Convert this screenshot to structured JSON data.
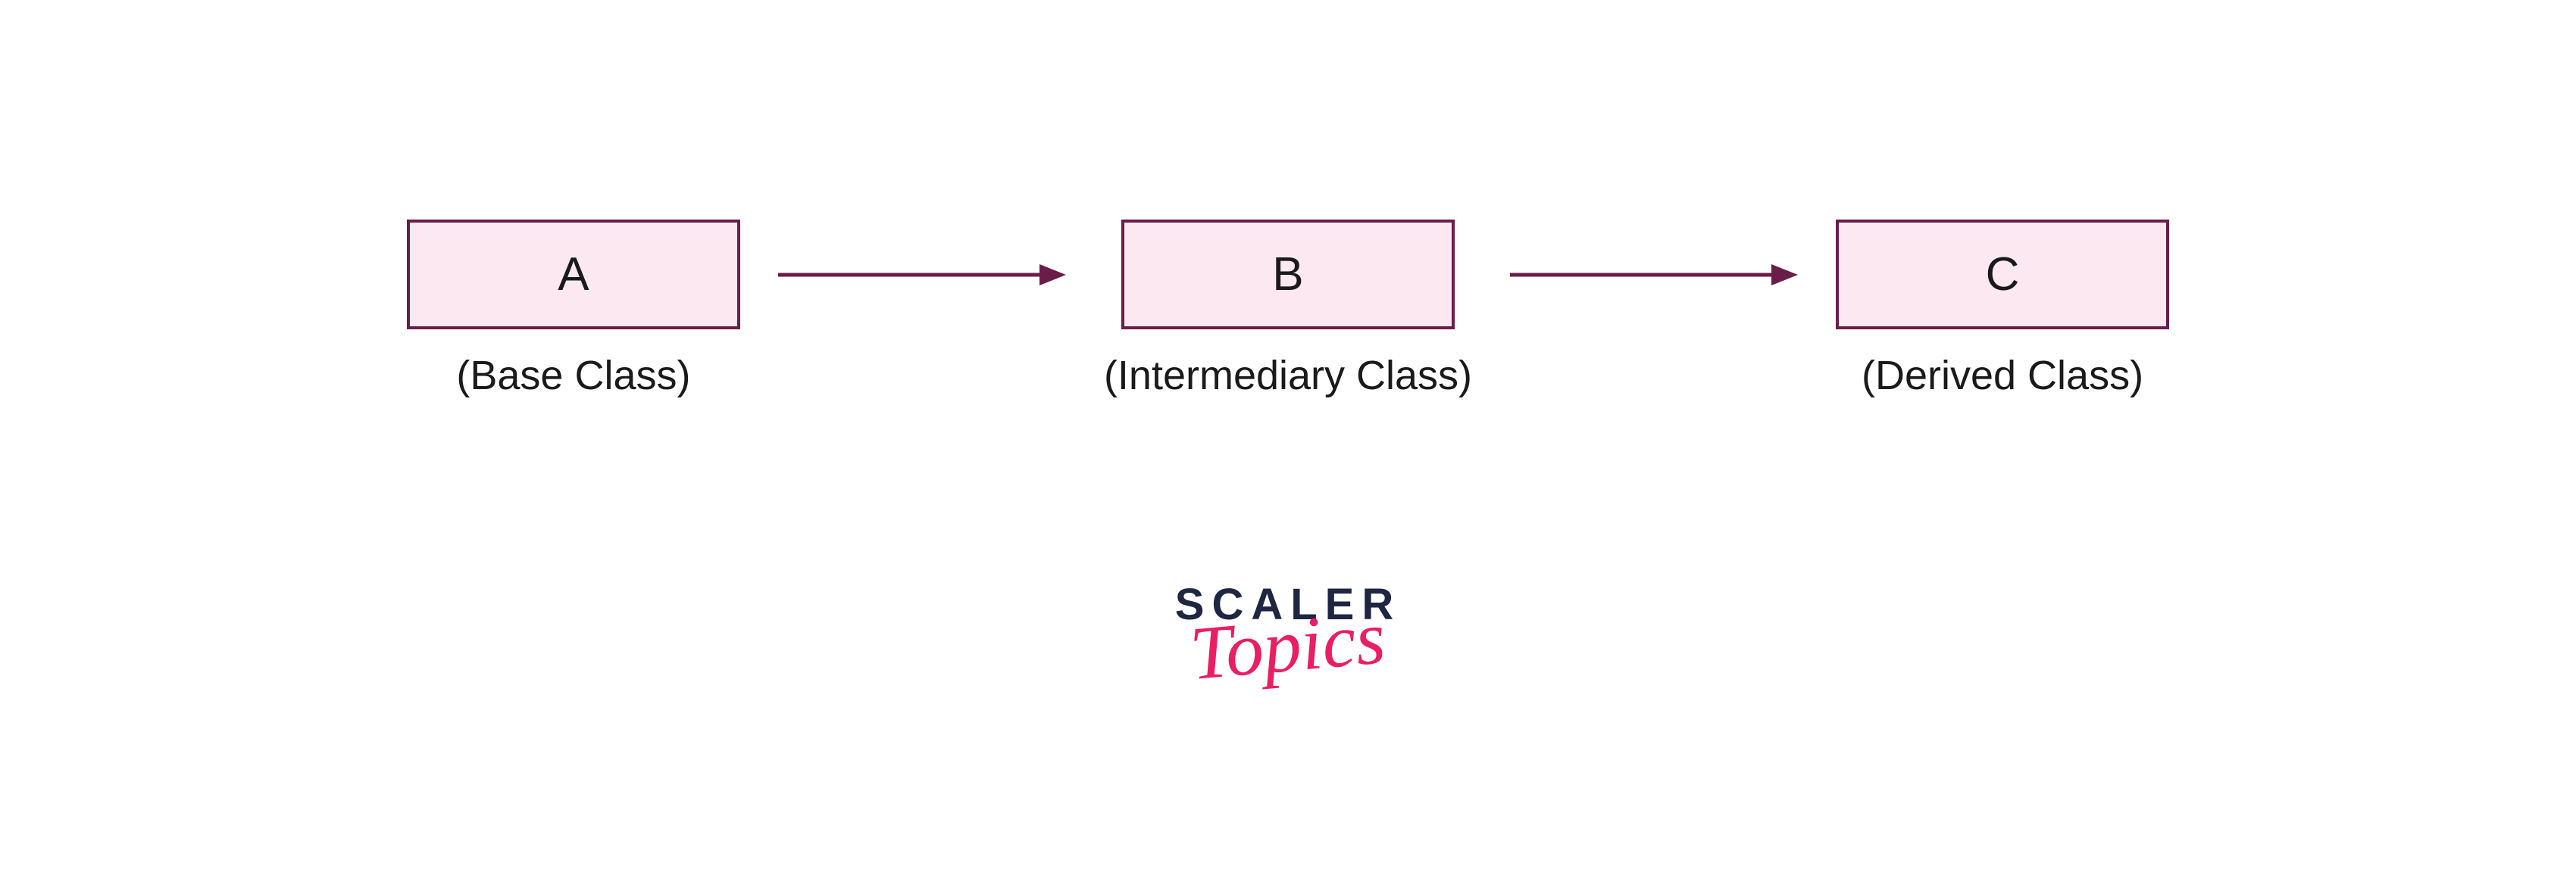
{
  "diagram": {
    "nodes": [
      {
        "letter": "A",
        "label": "(Base Class)"
      },
      {
        "letter": "B",
        "label": "(Intermediary Class)"
      },
      {
        "letter": "C",
        "label": "(Derived Class)"
      }
    ]
  },
  "logo": {
    "line1": "SCALER",
    "line2": "Topics"
  },
  "colors": {
    "box_fill": "#fce8f0",
    "box_border": "#6b1d4a",
    "arrow": "#6b1d4a",
    "logo_dark": "#1e2642",
    "logo_pink": "#e91e63"
  }
}
